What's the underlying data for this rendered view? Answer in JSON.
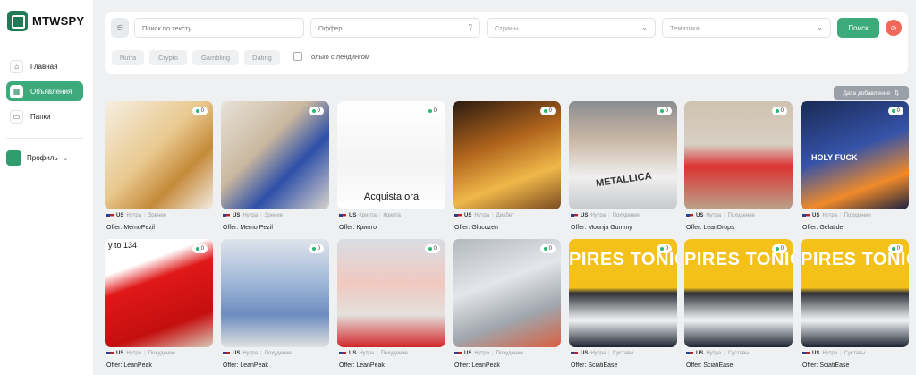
{
  "app": {
    "name": "MTWSPY"
  },
  "sidebar": {
    "items": [
      {
        "label": "Главная",
        "icon": "home-icon"
      },
      {
        "label": "Объявления",
        "icon": "grid-icon",
        "active": true
      },
      {
        "label": "Папки",
        "icon": "folder-icon"
      }
    ],
    "profile_label": "Профиль"
  },
  "filters": {
    "search_placeholder": "Поиск по тексту",
    "offer_placeholder": "Оффер",
    "countries_placeholder": "Страны",
    "topic_placeholder": "Тематика",
    "search_button": "Поиск",
    "chips": [
      "Nutra",
      "Crypto",
      "Gambling",
      "Dating"
    ],
    "landing_only": "Только с лендингом"
  },
  "sort": {
    "label": "Дата добавления"
  },
  "accent_color": "#3daa7c",
  "cards": [
    {
      "country": "US",
      "vertical": "Нутра",
      "tag": "Зрение",
      "offer": "Offer: MemoPezil",
      "count": "0",
      "overlay": ""
    },
    {
      "country": "US",
      "vertical": "Нутра",
      "tag": "Зрение",
      "offer": "Offer: Memo Pezil",
      "count": "0",
      "overlay": ""
    },
    {
      "country": "US",
      "vertical": "Крипта",
      "tag": "Крипта",
      "offer": "Offer: Крипто",
      "count": "0",
      "overlay": "Acquista ora"
    },
    {
      "country": "US",
      "vertical": "Нутра",
      "tag": "Диабет",
      "offer": "Offer: Glucozen",
      "count": "0",
      "overlay": ""
    },
    {
      "country": "US",
      "vertical": "Нутра",
      "tag": "Похудение",
      "offer": "Offer: Mounja Gummy",
      "count": "0",
      "overlay": "METALLICA"
    },
    {
      "country": "US",
      "vertical": "Нутра",
      "tag": "Похудение",
      "offer": "Offer: LeanDrops",
      "count": "0",
      "overlay": ""
    },
    {
      "country": "US",
      "vertical": "Нутра",
      "tag": "Похудение",
      "offer": "Offer: Gelatide",
      "count": "0",
      "overlay": "HOLY FUCK"
    },
    {
      "country": "US",
      "vertical": "Нутра",
      "tag": "Похудение",
      "offer": "Offer: LeanPeak",
      "count": "0",
      "overlay": "y to 134"
    },
    {
      "country": "US",
      "vertical": "Нутра",
      "tag": "Похудение",
      "offer": "Offer: LeanPeak",
      "count": "0",
      "overlay": ""
    },
    {
      "country": "US",
      "vertical": "Нутра",
      "tag": "Похудение",
      "offer": "Offer: LeanPeak",
      "count": "0",
      "overlay": ""
    },
    {
      "country": "US",
      "vertical": "Нутра",
      "tag": "Похудение",
      "offer": "Offer: LeanPeak",
      "count": "0",
      "overlay": ""
    },
    {
      "country": "US",
      "vertical": "Нутра",
      "tag": "Суставы",
      "offer": "Offer: SciatiEase",
      "count": "0",
      "overlay": "PIRES TONIC"
    },
    {
      "country": "US",
      "vertical": "Нутра",
      "tag": "Суставы",
      "offer": "Offer: SciatiEase",
      "count": "0",
      "overlay": "PIRES TONIC"
    },
    {
      "country": "US",
      "vertical": "Нутра",
      "tag": "Суставы",
      "offer": "Offer: SciatiEase",
      "count": "0",
      "overlay": "PIRES TONIC"
    }
  ]
}
